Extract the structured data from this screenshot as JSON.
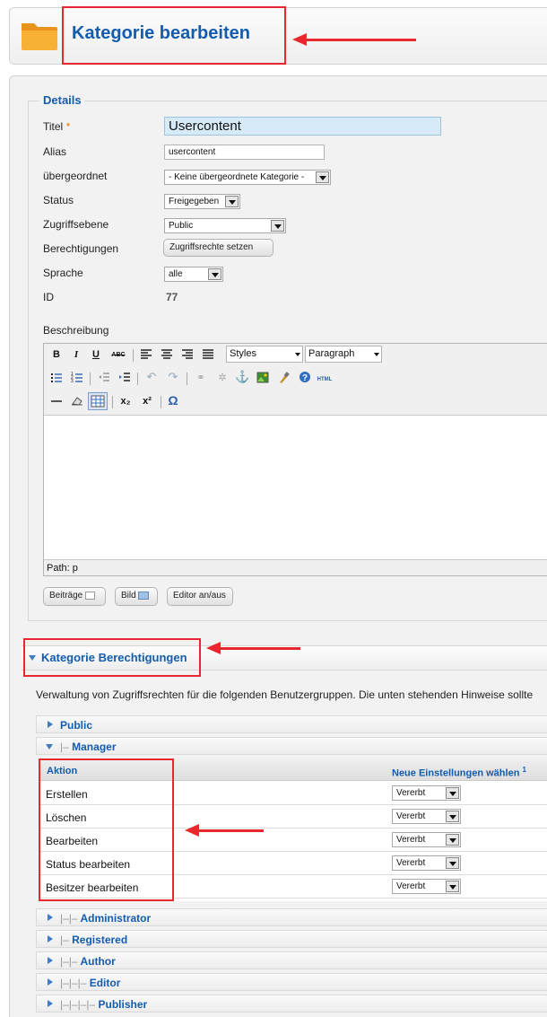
{
  "header": {
    "title": "Kategorie bearbeiten"
  },
  "details": {
    "legend": "Details",
    "fields": {
      "titel": {
        "label": "Titel",
        "required_mark": "*",
        "value": "Usercontent"
      },
      "alias": {
        "label": "Alias",
        "value": "usercontent"
      },
      "parent": {
        "label": "übergeordnet",
        "value": "- Keine übergeordnete Kategorie -"
      },
      "status": {
        "label": "Status",
        "value": "Freigegeben"
      },
      "access": {
        "label": "Zugriffsebene",
        "value": "Public"
      },
      "permissions": {
        "label": "Berechtigungen",
        "button": "Zugriffsrechte setzen"
      },
      "language": {
        "label": "Sprache",
        "value": "alle"
      },
      "id": {
        "label": "ID",
        "value": "77"
      }
    },
    "description_label": "Beschreibung"
  },
  "editor": {
    "toolbar": {
      "bold": "B",
      "italic": "I",
      "underline": "U",
      "strike": "ABC",
      "styles": "Styles",
      "paragraph": "Paragraph",
      "html": "HTML",
      "sub": "x₂",
      "sup": "x²",
      "omega": "Ω"
    },
    "path": "Path: p",
    "buttons": {
      "articles": "Beiträge",
      "image": "Bild",
      "toggle": "Editor an/aus"
    }
  },
  "permissions": {
    "title": "Kategorie Berechtigungen",
    "note": "Verwaltung von Zugriffsrechten für die folgenden Benutzergruppen. Die unten stehenden Hinweise sollte",
    "groups": {
      "public": {
        "prefix": "",
        "name": "Public"
      },
      "manager": {
        "prefix": "|–",
        "name": "Manager"
      },
      "administrator": {
        "prefix": "|–|–",
        "name": "Administrator"
      },
      "registered": {
        "prefix": "|–",
        "name": "Registered"
      },
      "author": {
        "prefix": "|–|–",
        "name": "Author"
      },
      "editor": {
        "prefix": "|–|–|–",
        "name": "Editor"
      },
      "publisher": {
        "prefix": "|–|–|–|–",
        "name": "Publisher"
      }
    },
    "table": {
      "col_action": "Aktion",
      "col_setting": "Neue Einstellungen wählen",
      "col_setting_sup": "1",
      "rows": [
        {
          "action": "Erstellen",
          "setting": "Vererbt"
        },
        {
          "action": "Löschen",
          "setting": "Vererbt"
        },
        {
          "action": "Bearbeiten",
          "setting": "Vererbt"
        },
        {
          "action": "Status bearbeiten",
          "setting": "Vererbt"
        },
        {
          "action": "Besitzer bearbeiten",
          "setting": "Vererbt"
        }
      ]
    }
  },
  "colors": {
    "accent": "#135cae",
    "annotation": "#e8282d",
    "folder": "#f6a623"
  }
}
